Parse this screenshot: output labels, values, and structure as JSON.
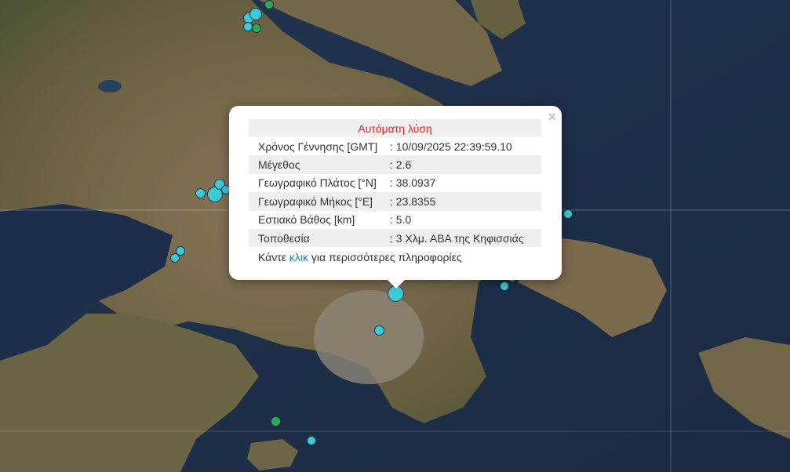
{
  "popup": {
    "title": "Αυτόματη λύση",
    "close_symbol": "×",
    "rows": [
      {
        "label": "Χρόνος Γέννησης [GMT]",
        "value": ": 10/09/2025 22:39:59.10"
      },
      {
        "label": "Μέγεθος",
        "value": ": 2.6"
      },
      {
        "label": "Γεωγραφικό Πλάτος [°N]",
        "value": ": 38.0937"
      },
      {
        "label": "Γεωγραφικό Μήκος [°E]",
        "value": ": 23.8355"
      },
      {
        "label": "Εστιακό Βάθος [km]",
        "value": ": 5.0"
      },
      {
        "label": "Τοποθεσία",
        "value": ": 3 Χλμ. ΑΒΑ της Κηφισσιάς"
      }
    ],
    "footer_prefix": "Κάντε ",
    "footer_link": "κλικ",
    "footer_suffix": " για περισσότερες πληροφορίες"
  },
  "colors": {
    "marker_recent": "#3ec9d6",
    "marker_older": "#2fa85a",
    "popup_title": "#e0201a",
    "link": "#1a7fa8"
  }
}
